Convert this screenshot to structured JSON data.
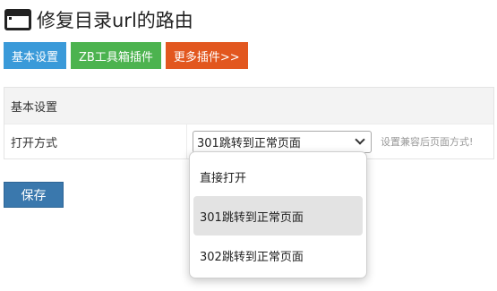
{
  "header": {
    "title": "修复目录url的路由",
    "icon": "window-icon"
  },
  "tabs": [
    {
      "label": "基本设置",
      "color": "#3a9ad9"
    },
    {
      "label": "ZB工具箱插件",
      "color": "#4cb34f"
    },
    {
      "label": "更多插件>>",
      "color": "#e2571f"
    }
  ],
  "settings": {
    "section_title": "基本设置",
    "open_mode": {
      "label": "打开方式",
      "selected": "301跳转到正常页面",
      "hint": "设置兼容后页面方式!",
      "options": [
        "直接打开",
        "301跳转到正常页面",
        "302跳转到正常页面"
      ]
    }
  },
  "save_label": "保存"
}
